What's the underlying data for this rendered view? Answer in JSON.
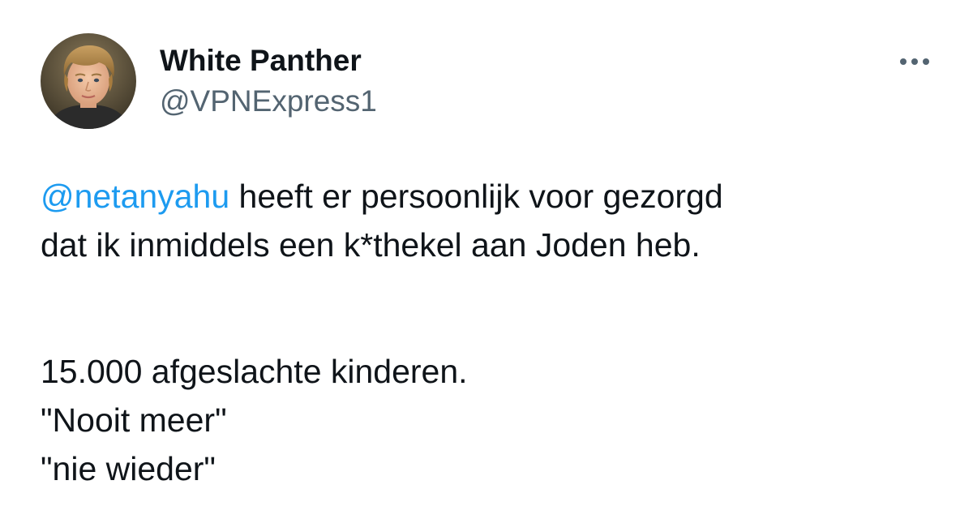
{
  "colors": {
    "text": "#0f1419",
    "secondary": "#536471",
    "link": "#1d9bf0",
    "background": "#ffffff"
  },
  "author": {
    "avatar_icon": "user-avatar-photo",
    "display_name": "White Panther",
    "handle": "@VPNExpress1"
  },
  "menu": {
    "icon": "more-options-icon"
  },
  "post": {
    "mention": "@netanyahu",
    "line1_rest": " heeft er persoonlijk voor gezorgd",
    "line2": "dat ik inmiddels een k*thekel aan Joden heb.",
    "line3": "15.000 afgeslachte kinderen.",
    "line4": "\"Nooit meer\"",
    "line5": "\"nie wieder\""
  }
}
